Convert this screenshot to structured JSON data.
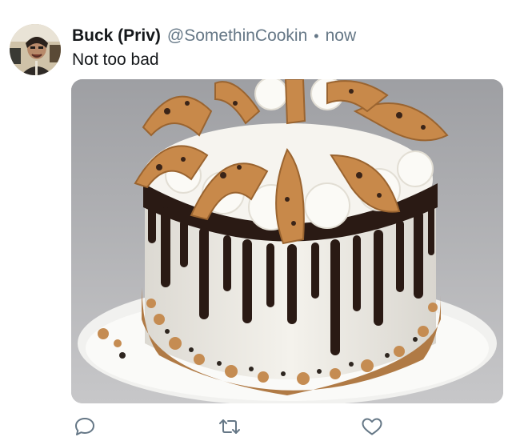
{
  "tweet": {
    "display_name": "Buck (Priv)",
    "handle": "@SomethinCookin",
    "separator": "•",
    "timestamp": "now",
    "text": "Not too bad"
  },
  "media": {
    "description_icon": "cake-photo"
  },
  "actions": {
    "reply_icon": "reply-icon",
    "retweet_icon": "retweet-icon",
    "like_icon": "like-icon"
  },
  "colors": {
    "primary_text": "#14171a",
    "secondary_text": "#657786",
    "icon_gray": "#657786"
  }
}
